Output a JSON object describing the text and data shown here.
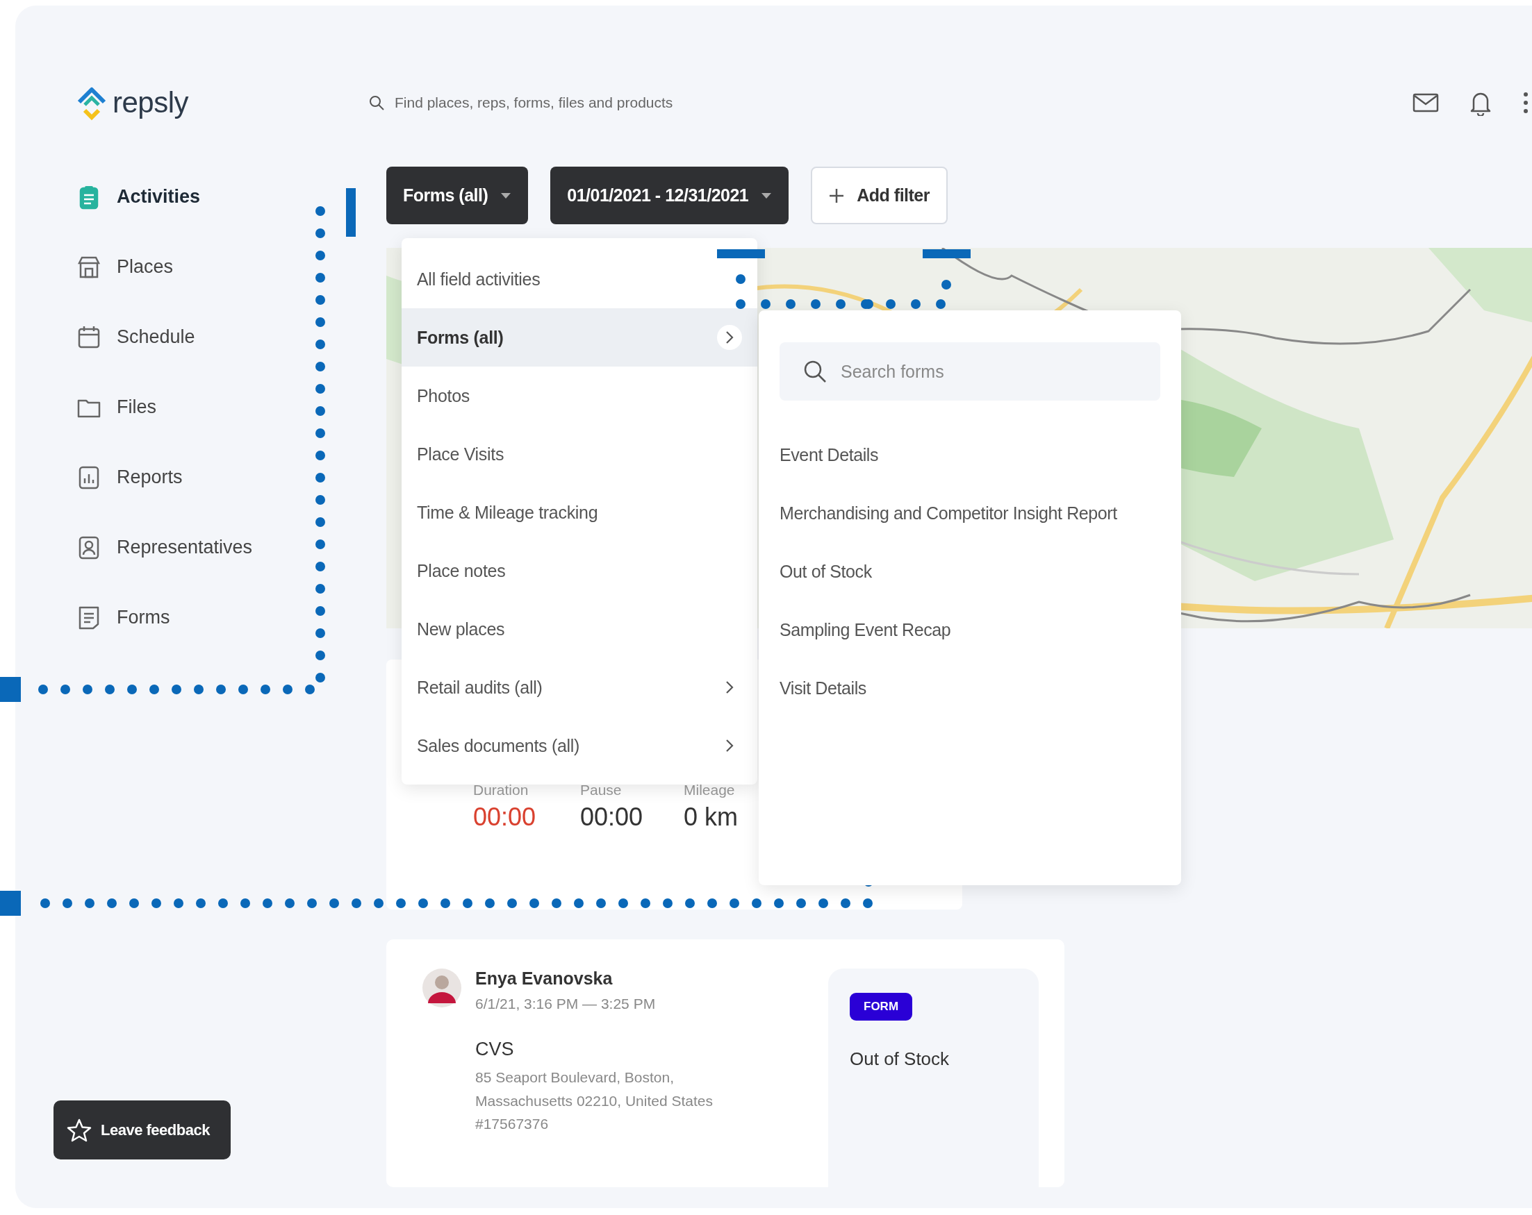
{
  "logo": {
    "text": "repsly"
  },
  "search": {
    "placeholder": "Find places, reps, forms, files and products"
  },
  "sidebar": {
    "items": [
      {
        "label": "Activities",
        "selected": true
      },
      {
        "label": "Places",
        "selected": false
      },
      {
        "label": "Schedule",
        "selected": false
      },
      {
        "label": "Files",
        "selected": false
      },
      {
        "label": "Reports",
        "selected": false
      },
      {
        "label": "Representatives",
        "selected": false
      },
      {
        "label": "Forms",
        "selected": false
      }
    ],
    "feedback_button": "Leave feedback"
  },
  "filters": [
    {
      "label": "Forms (all)",
      "kind": "dropdown"
    },
    {
      "label": "01/01/2021 - 12/31/2021",
      "kind": "dropdown"
    },
    {
      "label": "Add filter",
      "kind": "add"
    }
  ],
  "activity_menu": {
    "items": [
      {
        "label": "All field activities",
        "selected": false,
        "has_submenu": false
      },
      {
        "label": "Forms (all)",
        "selected": true,
        "has_submenu": true
      },
      {
        "label": "Photos",
        "selected": false,
        "has_submenu": false
      },
      {
        "label": "Place Visits",
        "selected": false,
        "has_submenu": false
      },
      {
        "label": "Time & Mileage tracking",
        "selected": false,
        "has_submenu": false
      },
      {
        "label": "Place notes",
        "selected": false,
        "has_submenu": false
      },
      {
        "label": "New places",
        "selected": false,
        "has_submenu": false
      },
      {
        "label": "Retail audits (all)",
        "selected": false,
        "has_submenu": true
      },
      {
        "label": "Sales documents (all)",
        "selected": false,
        "has_submenu": true
      }
    ]
  },
  "forms_menu": {
    "search": {
      "placeholder": "Search forms"
    },
    "items": [
      "Event Details",
      "Merchandising and Competitor Insight Report",
      "Out of Stock",
      "Sampling Event Recap",
      "Visit Details"
    ]
  },
  "stats": [
    {
      "label": "Duration",
      "value": "00:00",
      "alert": true
    },
    {
      "label": "Pause",
      "value": "00:00",
      "alert": false
    },
    {
      "label": "Mileage",
      "value": "0 km",
      "alert": false
    }
  ],
  "activity": {
    "rep": "Enya Evanovska",
    "time": "6/1/21, 3:16 PM — 3:25 PM",
    "place": "CVS",
    "address": "85 Seaport Boulevard, Boston,\nMassachusetts 02210, United States",
    "number": "#17567376",
    "badge": "FORM",
    "form": "Out of Stock"
  }
}
